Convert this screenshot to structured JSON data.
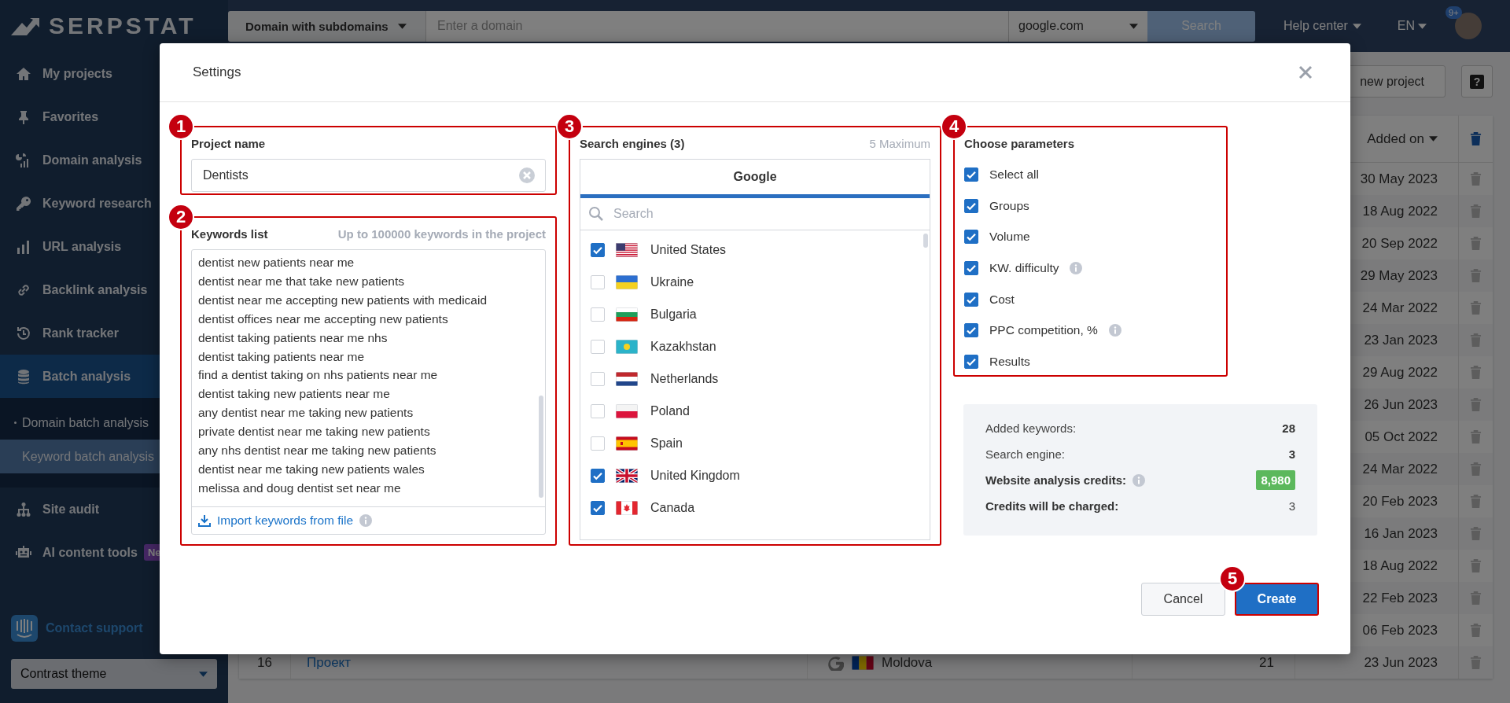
{
  "sidebar": {
    "logo": "SERPSTAT",
    "items": [
      {
        "label": "My projects",
        "kind": "home",
        "selected": false
      },
      {
        "label": "Favorites",
        "kind": "pin",
        "selected": false
      },
      {
        "label": "Domain analysis",
        "kind": "domain",
        "selected": false
      },
      {
        "label": "Keyword research",
        "kind": "key",
        "selected": false
      },
      {
        "label": "URL analysis",
        "kind": "bars",
        "selected": false
      },
      {
        "label": "Backlink analysis",
        "kind": "link",
        "selected": false
      },
      {
        "label": "Rank tracker",
        "kind": "history",
        "selected": false
      },
      {
        "label": "Batch analysis",
        "kind": "database",
        "selected": true,
        "children": [
          {
            "label": "Domain batch analysis",
            "selected": false
          },
          {
            "label": "Keyword batch analysis",
            "selected": true
          }
        ]
      },
      {
        "label": "Site audit",
        "kind": "sitemap",
        "selected": false
      },
      {
        "label": "AI content tools",
        "kind": "robot",
        "selected": false,
        "badge": "Ne"
      }
    ],
    "contact_support": "Contact support",
    "theme_select": {
      "value": "Contrast theme"
    }
  },
  "topbar": {
    "search_type": "Domain with subdomains",
    "domain_field": {
      "placeholder": "Enter a domain"
    },
    "engine_select": "google.com",
    "search_button": "Search",
    "help": "Help center",
    "language": "EN",
    "notifications": "9+"
  },
  "toolbar": {
    "new_project_button": "new project",
    "help_button": "?"
  },
  "table": {
    "date_header": "Added on",
    "rows": [
      {
        "date": "30 May 2023"
      },
      {
        "date": "18 Aug 2022"
      },
      {
        "date": "20 Sep 2022"
      },
      {
        "date": "29 May 2023"
      },
      {
        "date": "24 Mar 2022"
      },
      {
        "date": "23 Jan 2023"
      },
      {
        "date": "29 Aug 2022"
      },
      {
        "date": "26 Jun 2023"
      },
      {
        "date": "05 Oct 2022"
      },
      {
        "date": "24 Mar 2022"
      },
      {
        "date": "20 Feb 2023"
      },
      {
        "date": "16 Jan 2023"
      },
      {
        "date": "18 Aug 2022"
      },
      {
        "date": "22 Feb 2023"
      },
      {
        "date": "06 Feb 2023"
      },
      {
        "number": "16",
        "name": "Проект",
        "engine": {
          "name": "Moldova",
          "kind": "md"
        },
        "count": "21",
        "date": "23 Jun 2023"
      }
    ]
  },
  "modal": {
    "title": "Settings",
    "project": {
      "step": "1",
      "label": "Project name",
      "value": "Dentists"
    },
    "keywords": {
      "step": "2",
      "label": "Keywords list",
      "hint": "Up to 100000 keywords in the project",
      "lines": [
        "dentist new patients near me",
        "dentist near me that take new patients",
        "dentist near me accepting new patients with medicaid",
        "dentist offices near me accepting new patients",
        "dentist taking patients near me nhs",
        "dentist taking patients near me",
        "find a dentist taking on nhs patients near me",
        "dentist taking new patients near me",
        "any dentist near me taking new patients",
        "private dentist near me taking new patients",
        "any nhs dentist near me taking new patients",
        "dentist near me taking new patients wales",
        "melissa and doug dentist set near me"
      ],
      "import_link": "Import keywords from file"
    },
    "engines": {
      "step": "3",
      "label": "Search engines (3)",
      "hint": "5 Maximum",
      "tabs": [
        {
          "label": "Google",
          "selected": true
        }
      ],
      "search": {
        "placeholder": "Search"
      },
      "countries": [
        {
          "name": "United States",
          "kind": "us",
          "checked": true
        },
        {
          "name": "Ukraine",
          "kind": "ua",
          "checked": false
        },
        {
          "name": "Bulgaria",
          "kind": "bg",
          "checked": false
        },
        {
          "name": "Kazakhstan",
          "kind": "kz",
          "checked": false
        },
        {
          "name": "Netherlands",
          "kind": "nl",
          "checked": false
        },
        {
          "name": "Poland",
          "kind": "pl",
          "checked": false
        },
        {
          "name": "Spain",
          "kind": "es",
          "checked": false
        },
        {
          "name": "United Kingdom",
          "kind": "gb",
          "checked": true
        },
        {
          "name": "Canada",
          "kind": "ca",
          "checked": true
        }
      ]
    },
    "parameters": {
      "step": "4",
      "label": "Choose parameters",
      "items": [
        {
          "label": "Select all",
          "checked": true,
          "info": false
        },
        {
          "label": "Groups",
          "checked": true,
          "info": false
        },
        {
          "label": "Volume",
          "checked": true,
          "info": false
        },
        {
          "label": "KW. difficulty",
          "checked": true,
          "info": true
        },
        {
          "label": "Cost",
          "checked": true,
          "info": false
        },
        {
          "label": "PPC competition, %",
          "checked": true,
          "info": true
        },
        {
          "label": "Results",
          "checked": true,
          "info": false
        }
      ]
    },
    "summary": [
      {
        "label": "Added keywords:",
        "value": "28",
        "kind": "plain"
      },
      {
        "label": "Search engine:",
        "value": "3",
        "kind": "plain"
      },
      {
        "label": "Website analysis credits:",
        "value": "8,980",
        "kind": "credits"
      },
      {
        "label": "Credits will be charged:",
        "value": "3",
        "kind": "bold"
      }
    ],
    "cancel_button": "Cancel",
    "create_button": {
      "label": "Create",
      "step": "5"
    }
  }
}
